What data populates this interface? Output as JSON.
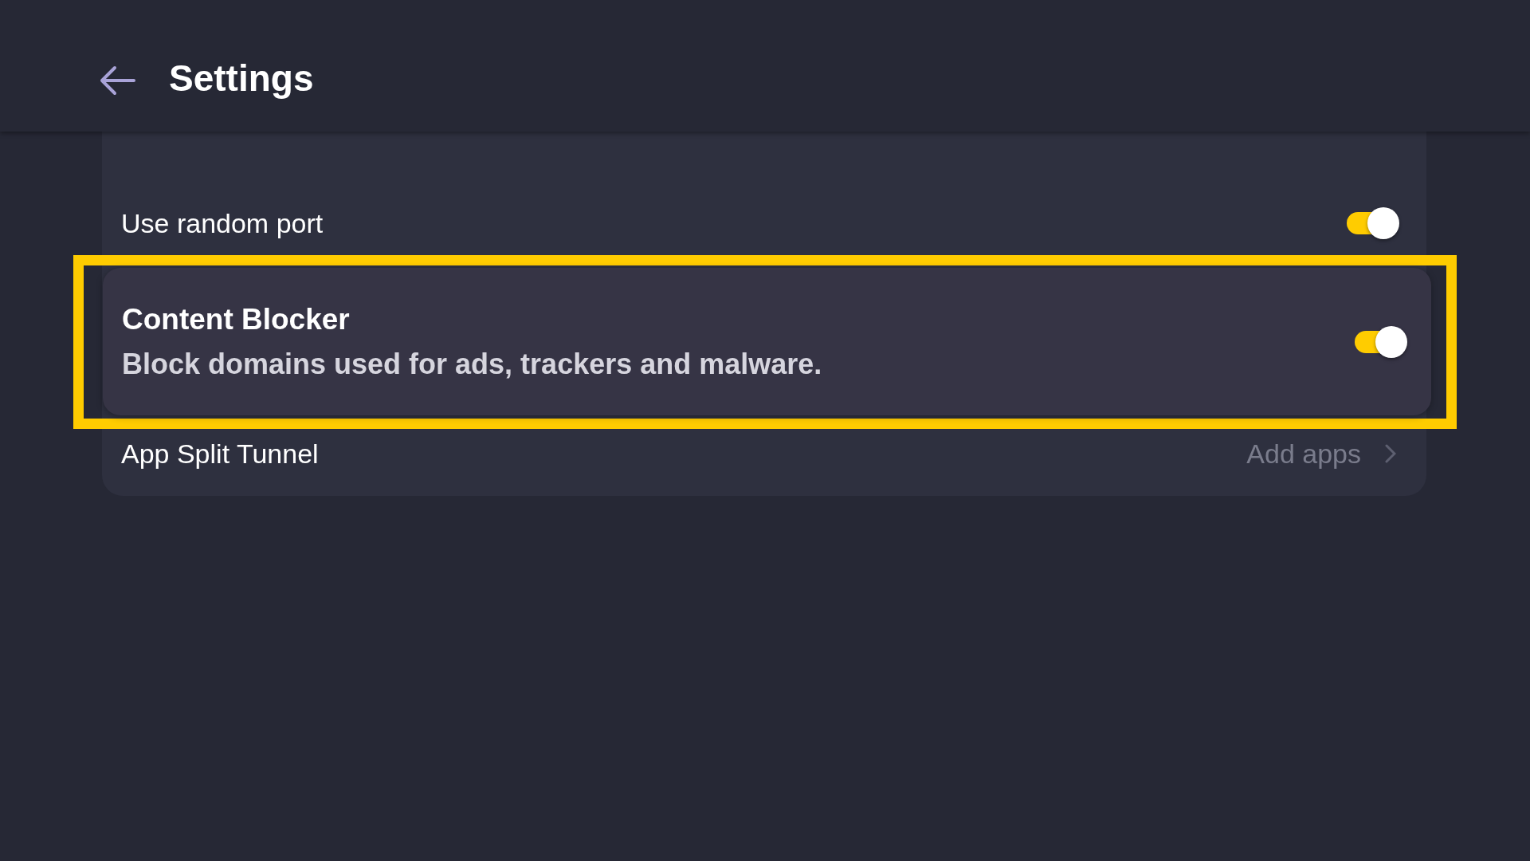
{
  "header": {
    "title": "Settings"
  },
  "settings": [
    {
      "kind": "toggle",
      "label": "Use random port",
      "on": true,
      "highlighted": false
    },
    {
      "kind": "toggle",
      "label": "Content Blocker",
      "description": "Block domains used for ads, trackers and malware.",
      "on": true,
      "highlighted": true
    },
    {
      "kind": "link",
      "label": "App Split Tunnel",
      "value": "Add apps"
    }
  ]
}
